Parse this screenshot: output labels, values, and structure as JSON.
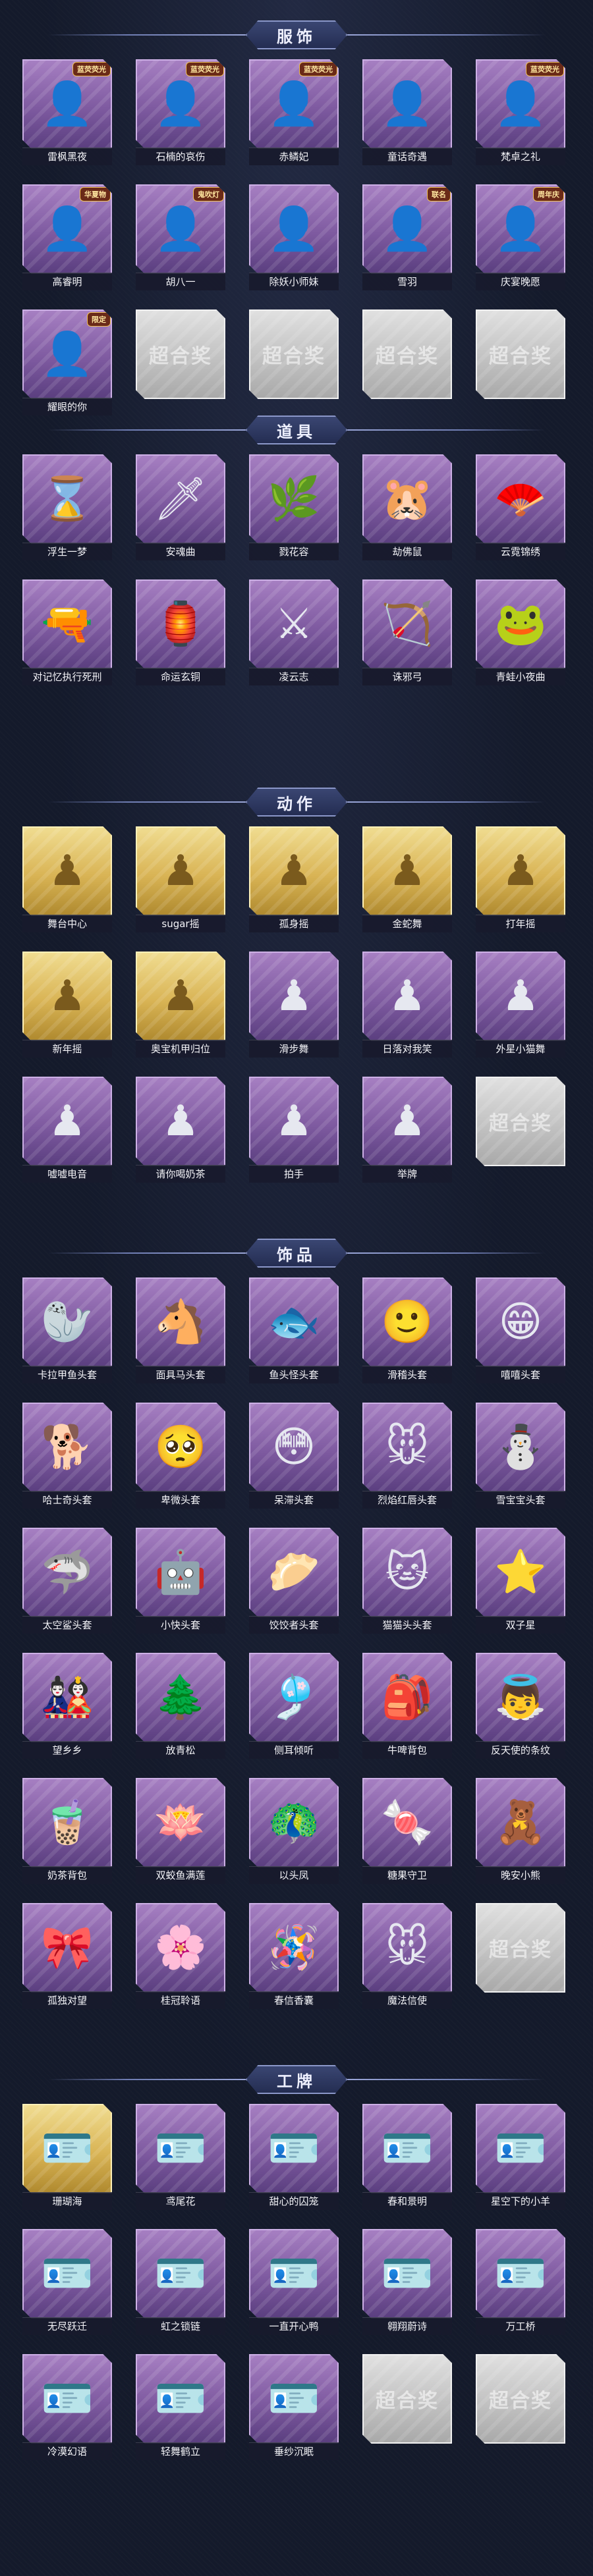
{
  "sections": [
    {
      "title": "服饰",
      "items": [
        {
          "label": "雷枫黑夜",
          "icon": "character-portrait-icon",
          "icon_char": "👤",
          "badge": "蓝荧荧光"
        },
        {
          "label": "石楠的哀伤",
          "icon": "character-portrait-icon",
          "icon_char": "👤",
          "badge": "蓝荧荧光"
        },
        {
          "label": "赤鳞妃",
          "icon": "character-portrait-icon",
          "icon_char": "👤",
          "badge": "蓝荧荧光"
        },
        {
          "label": "童话奇遇",
          "icon": "character-portrait-icon",
          "icon_char": "👤",
          "badge": ""
        },
        {
          "label": "梵卓之礼",
          "icon": "character-portrait-icon",
          "icon_char": "👤",
          "badge": "蓝荧荧光"
        },
        {
          "label": "高睿明",
          "icon": "character-portrait-icon",
          "icon_char": "👤",
          "badge": "华夏物"
        },
        {
          "label": "胡八一",
          "icon": "character-portrait-icon",
          "icon_char": "👤",
          "badge": "鬼吹灯"
        },
        {
          "label": "除妖小师妹",
          "icon": "character-portrait-icon",
          "icon_char": "👤",
          "badge": ""
        },
        {
          "label": "雪羽",
          "icon": "character-portrait-icon",
          "icon_char": "👤",
          "badge": "联名"
        },
        {
          "label": "庆宴晚愿",
          "icon": "character-portrait-icon",
          "icon_char": "👤",
          "badge": "周年庆"
        },
        {
          "label": "耀眼的你",
          "icon": "character-portrait-icon",
          "icon_char": "👤",
          "badge": "限定"
        },
        {
          "placeholder": true,
          "watermark": "超合奖"
        },
        {
          "placeholder": true,
          "watermark": "超合奖"
        },
        {
          "placeholder": true,
          "watermark": "超合奖"
        },
        {
          "placeholder": true,
          "watermark": "超合奖"
        }
      ]
    },
    {
      "title": "道具",
      "items": [
        {
          "label": "浮生一梦",
          "icon": "hourglass-icon",
          "icon_char": "⌛"
        },
        {
          "label": "安魂曲",
          "icon": "blade-icon",
          "icon_char": "🗡"
        },
        {
          "label": "戮花容",
          "icon": "branch-icon",
          "icon_char": "🌿"
        },
        {
          "label": "劫佛鼠",
          "icon": "hamster-icon",
          "icon_char": "🐹"
        },
        {
          "label": "云霓锦绣",
          "icon": "fan-icon",
          "icon_char": "🪭"
        },
        {
          "label": "对记忆执行死刑",
          "icon": "gun-icon",
          "icon_char": "🔫"
        },
        {
          "label": "命运玄铜",
          "icon": "lantern-icon",
          "icon_char": "🏮"
        },
        {
          "label": "凌云志",
          "icon": "sword-icon",
          "icon_char": "⚔"
        },
        {
          "label": "诛邪弓",
          "icon": "bow-icon",
          "icon_char": "🏹"
        },
        {
          "label": "青蛙小夜曲",
          "icon": "frog-icon",
          "icon_char": "🐸"
        }
      ]
    },
    {
      "title": "动作",
      "items": [
        {
          "label": "舞台中心",
          "icon": "silhouette-icon",
          "icon_char": "♟",
          "gold": true
        },
        {
          "label": "sugar摇",
          "icon": "silhouette-icon",
          "icon_char": "♟",
          "gold": true
        },
        {
          "label": "孤身摇",
          "icon": "silhouette-icon",
          "icon_char": "♟",
          "gold": true
        },
        {
          "label": "金蛇舞",
          "icon": "silhouette-icon",
          "icon_char": "♟",
          "gold": true
        },
        {
          "label": "打年摇",
          "icon": "silhouette-icon",
          "icon_char": "♟",
          "gold": true
        },
        {
          "label": "新年摇",
          "icon": "silhouette-icon",
          "icon_char": "♟",
          "gold": true
        },
        {
          "label": "奥宝机甲归位",
          "icon": "silhouette-icon",
          "icon_char": "♟",
          "gold": true
        },
        {
          "label": "滑步舞",
          "icon": "silhouette-icon",
          "icon_char": "♟"
        },
        {
          "label": "日落对我笑",
          "icon": "silhouette-icon",
          "icon_char": "♟"
        },
        {
          "label": "外星小猫舞",
          "icon": "silhouette-icon",
          "icon_char": "♟"
        },
        {
          "label": "嘘嘘电音",
          "icon": "silhouette-icon",
          "icon_char": "♟"
        },
        {
          "label": "请你喝奶茶",
          "icon": "silhouette-icon",
          "icon_char": "♟"
        },
        {
          "label": "拍手",
          "icon": "silhouette-icon",
          "icon_char": "♟"
        },
        {
          "label": "举牌",
          "icon": "silhouette-icon",
          "icon_char": "♟"
        },
        {
          "placeholder": true,
          "watermark": "超合奖"
        }
      ]
    },
    {
      "title": "饰品",
      "items": [
        {
          "label": "卡拉甲鱼头套",
          "icon": "seal-head-icon",
          "icon_char": "🦭"
        },
        {
          "label": "面具马头套",
          "icon": "horse-head-icon",
          "icon_char": "🐴"
        },
        {
          "label": "鱼头怪头套",
          "icon": "fish-head-icon",
          "icon_char": "🐟"
        },
        {
          "label": "滑稽头套",
          "icon": "smiley-icon",
          "icon_char": "🙂"
        },
        {
          "label": "嘻嘻头套",
          "icon": "grin-icon",
          "icon_char": "😁"
        },
        {
          "label": "哈士奇头套",
          "icon": "dog-icon",
          "icon_char": "🐕"
        },
        {
          "label": "卑微头套",
          "icon": "pleading-face-icon",
          "icon_char": "🥺"
        },
        {
          "label": "呆滞头套",
          "icon": "flushed-face-icon",
          "icon_char": "😳"
        },
        {
          "label": "烈焰红唇头套",
          "icon": "pikachu-icon",
          "icon_char": "🐭"
        },
        {
          "label": "雪宝宝头套",
          "icon": "snowman-icon",
          "icon_char": "⛄"
        },
        {
          "label": "太空鲨头套",
          "icon": "shark-icon",
          "icon_char": "🦈"
        },
        {
          "label": "小快头套",
          "icon": "robot-icon",
          "icon_char": "🤖"
        },
        {
          "label": "饺饺者头套",
          "icon": "dumpling-icon",
          "icon_char": "🥟"
        },
        {
          "label": "猫猫头头套",
          "icon": "cat-icon",
          "icon_char": "🐱"
        },
        {
          "label": "双子星",
          "icon": "star-icon",
          "icon_char": "⭐"
        },
        {
          "label": "望乡乡",
          "icon": "doll-icon",
          "icon_char": "🎎"
        },
        {
          "label": "放青松",
          "icon": "pine-icon",
          "icon_char": "🌲"
        },
        {
          "label": "侧耳倾听",
          "icon": "bell-icon",
          "icon_char": "🎐"
        },
        {
          "label": "牛啤背包",
          "icon": "backpack-icon",
          "icon_char": "🎒"
        },
        {
          "label": "反天使的条纹",
          "icon": "angel-icon",
          "icon_char": "👼"
        },
        {
          "label": "奶茶背包",
          "icon": "milk-tea-icon",
          "icon_char": "🧋"
        },
        {
          "label": "双蛟鱼满莲",
          "icon": "lotus-icon",
          "icon_char": "🪷"
        },
        {
          "label": "以头凤",
          "icon": "phoenix-icon",
          "icon_char": "🦚"
        },
        {
          "label": "糖果守卫",
          "icon": "candy-icon",
          "icon_char": "🍬"
        },
        {
          "label": "晚安小熊",
          "icon": "bear-icon",
          "icon_char": "🧸"
        },
        {
          "label": "孤独对望",
          "icon": "charm-icon",
          "icon_char": "🎀"
        },
        {
          "label": "桂冠聆语",
          "icon": "laurel-icon",
          "icon_char": "🌸"
        },
        {
          "label": "春信香囊",
          "icon": "sachet-icon",
          "icon_char": "🪅"
        },
        {
          "label": "魔法信使",
          "icon": "mouse-icon",
          "icon_char": "🐭"
        },
        {
          "placeholder": true,
          "watermark": "超合奖"
        }
      ]
    },
    {
      "title": "工牌",
      "items": [
        {
          "label": "珊瑚海",
          "icon": "badge-card-icon",
          "icon_char": "🪪",
          "gold": true
        },
        {
          "label": "鸢尾花",
          "icon": "badge-card-icon",
          "icon_char": "🪪"
        },
        {
          "label": "甜心的囚笼",
          "icon": "badge-card-icon",
          "icon_char": "🪪"
        },
        {
          "label": "春和景明",
          "icon": "badge-card-icon",
          "icon_char": "🪪"
        },
        {
          "label": "星空下的小羊",
          "icon": "badge-card-icon",
          "icon_char": "🪪"
        },
        {
          "label": "无尽跃迁",
          "icon": "badge-card-icon",
          "icon_char": "🪪"
        },
        {
          "label": "虹之锁链",
          "icon": "badge-card-icon",
          "icon_char": "🪪"
        },
        {
          "label": "一直开心鸭",
          "icon": "badge-card-icon",
          "icon_char": "🪪"
        },
        {
          "label": "翱翔蔚诗",
          "icon": "badge-card-icon",
          "icon_char": "🪪"
        },
        {
          "label": "万工桥",
          "icon": "badge-card-icon",
          "icon_char": "🪪"
        },
        {
          "label": "冷漠幻语",
          "icon": "badge-card-icon",
          "icon_char": "🪪"
        },
        {
          "label": "轻舞鹤立",
          "icon": "badge-card-icon",
          "icon_char": "🪪"
        },
        {
          "label": "垂纱沉眠",
          "icon": "badge-card-icon",
          "icon_char": "🪪"
        },
        {
          "placeholder": true,
          "watermark": "超合奖"
        },
        {
          "placeholder": true,
          "watermark": "超合奖"
        }
      ]
    }
  ]
}
